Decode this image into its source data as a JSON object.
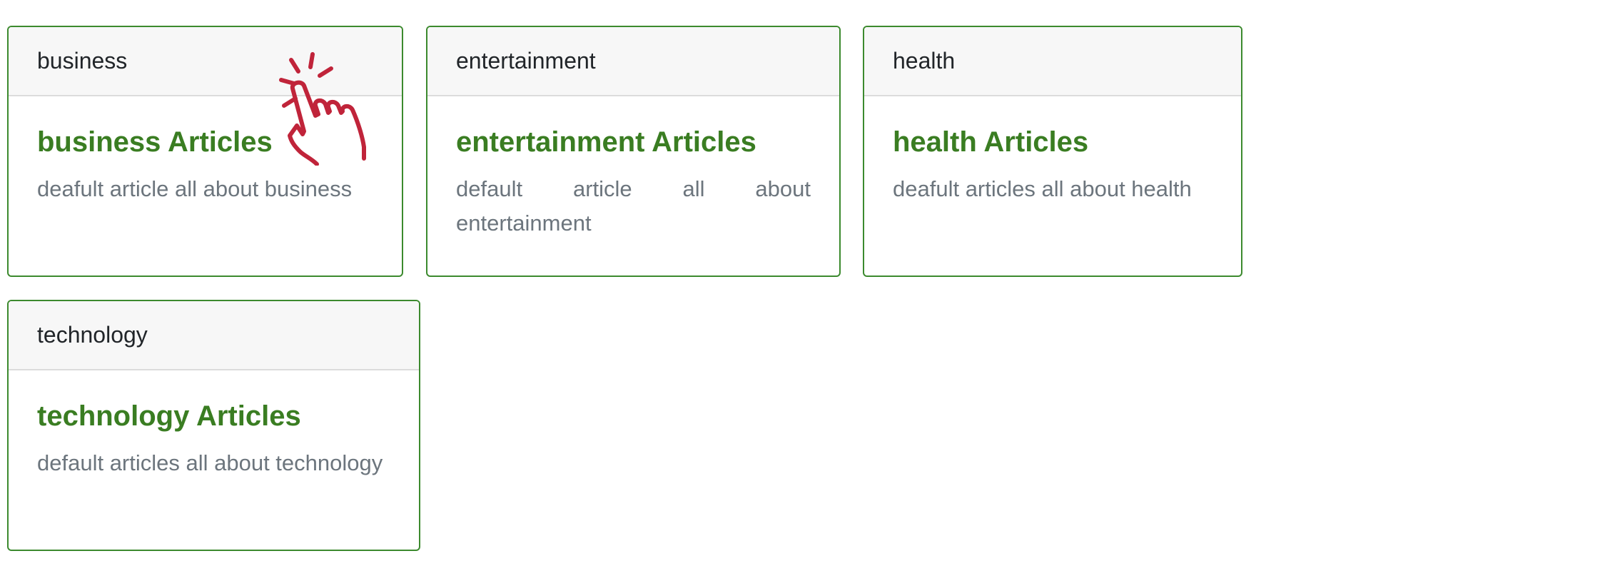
{
  "categories": [
    {
      "header": "business",
      "title": "business Articles",
      "description": "deafult article all about business"
    },
    {
      "header": "entertainment",
      "title": "entertainment Articles",
      "description": "default article all about entertainment"
    },
    {
      "header": "health",
      "title": "health Articles",
      "description": "deafult articles all about health"
    },
    {
      "header": "technology",
      "title": "technology Articles",
      "description": "default articles all about technology"
    }
  ],
  "theme": {
    "card_border": "#3c8a2e",
    "title_color": "#3a7d22",
    "text_color": "#6c757d",
    "cursor_color": "#c0243a"
  },
  "cursor_icon": "pointing-hand-click-icon"
}
